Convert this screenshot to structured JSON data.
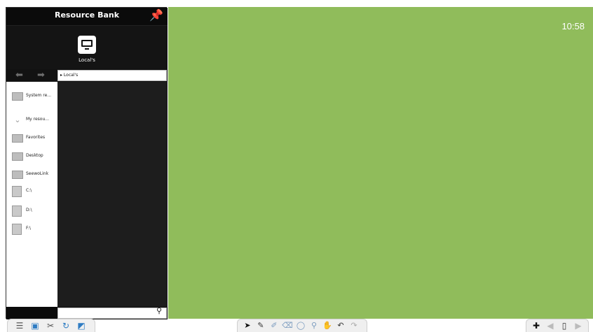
{
  "panel": {
    "title": "Resource Bank",
    "pin_icon": "pin-icon"
  },
  "local_tile": {
    "label": "Local's",
    "icon": "monitor-icon"
  },
  "nav": {
    "path": "▸ Local's"
  },
  "tree": {
    "items": [
      {
        "label": "System re...",
        "icon": "folder-icon"
      },
      {
        "label": "My resou...",
        "icon": "chevron-down-icon"
      },
      {
        "label": "Favorites",
        "icon": "folder-icon"
      },
      {
        "label": "Desktop",
        "icon": "folder-icon"
      },
      {
        "label": "SeewoLink",
        "icon": "folder-icon"
      },
      {
        "label": "C:\\",
        "icon": "drive-icon"
      },
      {
        "label": "D:\\",
        "icon": "drive-icon"
      },
      {
        "label": "F:\\",
        "icon": "drive-icon"
      }
    ]
  },
  "search": {
    "placeholder": ""
  },
  "board": {
    "clock": "10:58",
    "color": "#90bc5b"
  },
  "toolbar_left": {
    "buttons": [
      "menu-icon",
      "screen-icon",
      "tools-icon",
      "refresh-icon",
      "share-icon"
    ]
  },
  "toolbar_mid": {
    "tools": [
      "select-icon",
      "pen-icon",
      "highlighter-icon",
      "eraser-icon",
      "shape-icon",
      "magnifier-icon",
      "hand-icon",
      "undo-icon",
      "redo-icon"
    ]
  },
  "toolbar_right": {
    "buttons": [
      "add-page-icon",
      "prev-page-icon",
      "page-count-icon",
      "next-page-icon"
    ]
  }
}
